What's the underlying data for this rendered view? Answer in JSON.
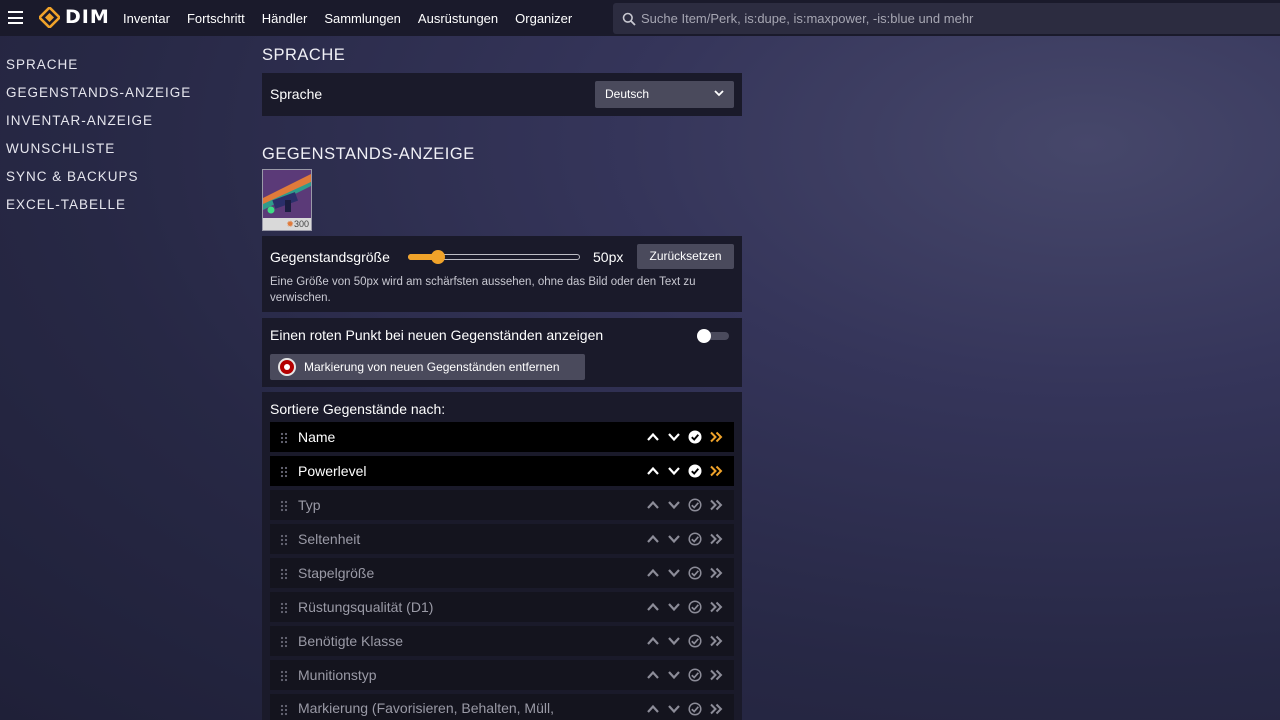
{
  "header": {
    "logo_text": "DIM",
    "nav": [
      "Inventar",
      "Fortschritt",
      "Händler",
      "Sammlungen",
      "Ausrüstungen",
      "Organizer"
    ],
    "search_placeholder": "Suche Item/Perk, is:dupe, is:maxpower, -is:blue und mehr",
    "accent_color": "#f0a32a"
  },
  "sidebar": {
    "items": [
      "SPRACHE",
      "GEGENSTANDS-ANZEIGE",
      "INVENTAR-ANZEIGE",
      "WUNSCHLISTE",
      "SYNC & BACKUPS",
      "EXCEL-TABELLE"
    ]
  },
  "language": {
    "section_title": "SPRACHE",
    "label": "Sprache",
    "selected": "Deutsch"
  },
  "item_display": {
    "section_title": "GEGENSTANDS-ANZEIGE",
    "preview_power": "300",
    "size_label": "Gegenstandsgröße",
    "size_value": "50px",
    "size_fraction": 0.14,
    "reset_label": "Zurücksetzen",
    "size_help": "Eine Größe von 50px wird am schärfsten aussehen, ohne das Bild oder den Text zu verwischen.",
    "red_dot_label": "Einen roten Punkt bei neuen Gegenständen anzeigen",
    "red_dot_enabled": false,
    "clear_new_label": "Markierung von neuen Gegenständen entfernen",
    "sort_label": "Sortiere Gegenstände nach:",
    "sort_items": [
      {
        "name": "Name",
        "enabled": true
      },
      {
        "name": "Powerlevel",
        "enabled": true
      },
      {
        "name": "Typ",
        "enabled": false
      },
      {
        "name": "Seltenheit",
        "enabled": false
      },
      {
        "name": "Stapelgröße",
        "enabled": false
      },
      {
        "name": "Rüstungsqualität (D1)",
        "enabled": false
      },
      {
        "name": "Benötigte Klasse",
        "enabled": false
      },
      {
        "name": "Munitionstyp",
        "enabled": false
      },
      {
        "name": "Markierung (Favorisieren, Behalten, Müll,",
        "enabled": false
      }
    ]
  }
}
